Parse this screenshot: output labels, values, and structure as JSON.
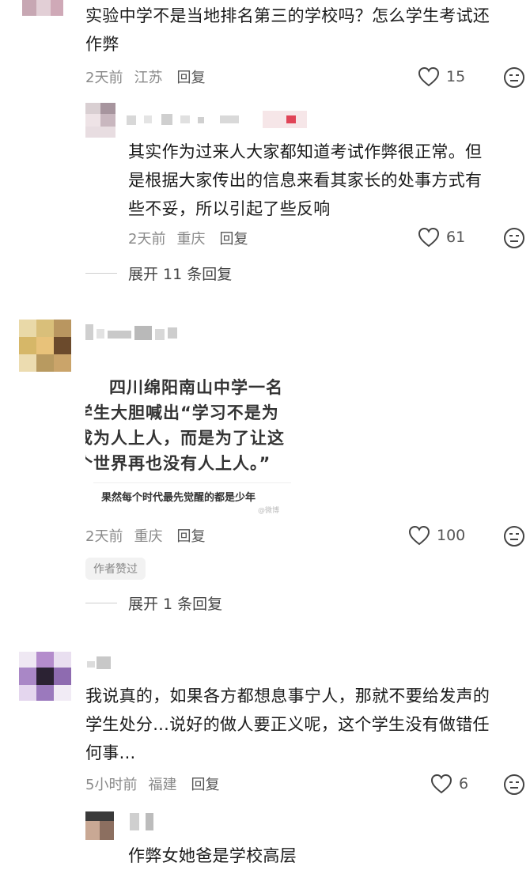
{
  "comments": [
    {
      "text_lines": [
        "实验中学不是当地排名第三的学校吗？怎么学生考试还",
        "作弊"
      ],
      "time": "2天前",
      "location": "江苏",
      "reply": "回复",
      "likes": "15"
    },
    {
      "text_lines": [
        "其实作为过来人大家都知道考试作弊很正常。但",
        "是根据大家传出的信息来看其家长的处事方式有",
        "些不妥，所以引起了些反响"
      ],
      "time": "2天前",
      "location": "重庆",
      "reply": "回复",
      "likes": "61",
      "expand": "展开 11 条回复"
    },
    {
      "image_lines": [
        "四川绵阳南山中学一名",
        "学生大胆喊出“学习不是为",
        "成为人上人，而是为了让这",
        "个世界再也没有人上人。”"
      ],
      "image_caption": "果然每个时代最先觉醒的都是少年",
      "image_watermark": "@微博",
      "time": "2天前",
      "location": "重庆",
      "reply": "回复",
      "likes": "100",
      "badge": "作者赞过",
      "expand": "展开 1 条回复"
    },
    {
      "text_lines": [
        "我说真的，如果各方都想息事宁人，那就不要给发声的",
        "学生处分...说好的做人要正义呢，这个学生没有做错任",
        "何事..."
      ],
      "time": "5小时前",
      "location": "福建",
      "reply": "回复",
      "likes": "6"
    },
    {
      "text_lines": [
        "作弊女她爸是学校高层"
      ]
    }
  ],
  "icons": {
    "like": "heart-outline-icon",
    "dislike": "neutral-face-icon"
  },
  "colors": {
    "text": "#1a1a1a",
    "meta": "#8a8a8a",
    "badge_bg": "#f2f2f2"
  }
}
